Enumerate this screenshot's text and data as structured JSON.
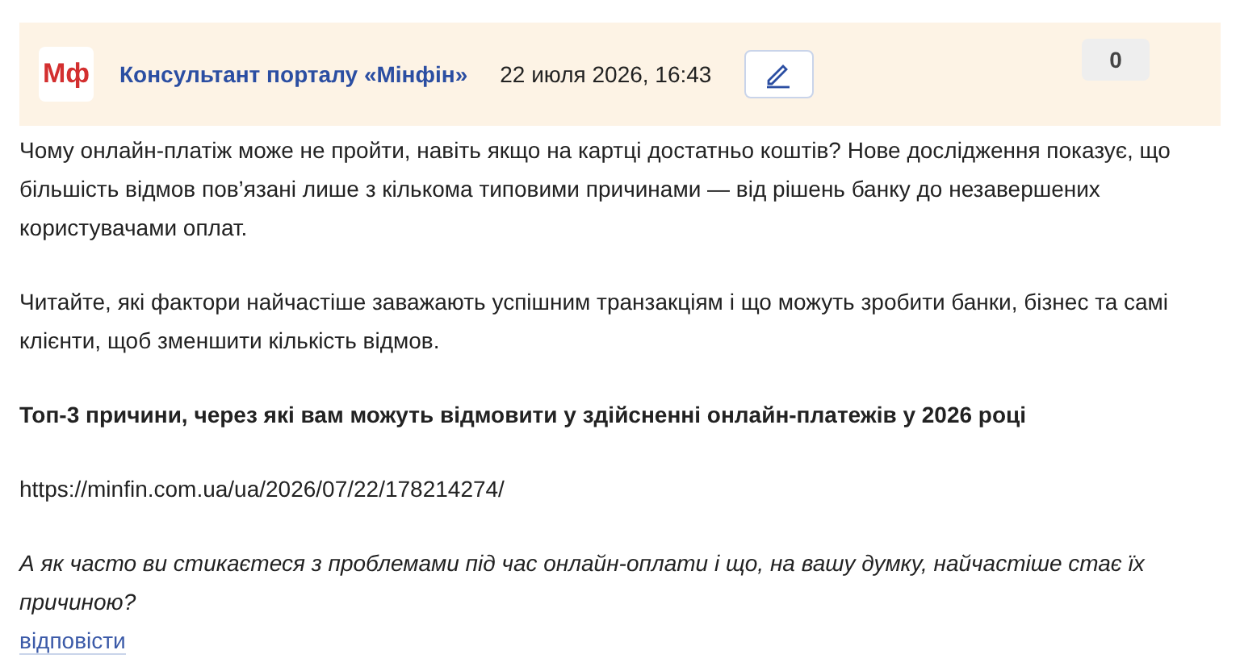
{
  "header": {
    "logo": "Мф",
    "author": "Консультант порталу «Мінфін»",
    "date": "22 июля 2026, 16:43",
    "votes": "0"
  },
  "body": [
    {
      "kind": "text",
      "text": "Чому онлайн-платіж може не пройти, навіть якщо на картці достатньо коштів? Нове дослідження показує, що більшість відмов пов’язані лише з кількома типовими причинами — від рішень банку до незавершених користувачами оплат."
    },
    {
      "kind": "text",
      "text": "Читайте, які фактори найчастіше заважають успішним транзакціям і що можуть зробити банки, бізнес та самі клієнти, щоб зменшити кількість відмов."
    },
    {
      "kind": "bold",
      "text": "Топ-3 причини, через які вам можуть відмовити у здійсненні онлайн-платежів у 2026 році"
    },
    {
      "kind": "url",
      "text": "https://minfin.com.ua/ua/2026/07/22/178214274/"
    },
    {
      "kind": "italic",
      "text": "А як часто ви стикаєтеся з проблемами під час онлайн-оплати і що, на вашу думку, найчастіше стає їх причиною?"
    }
  ],
  "reply_link": "відповісти"
}
